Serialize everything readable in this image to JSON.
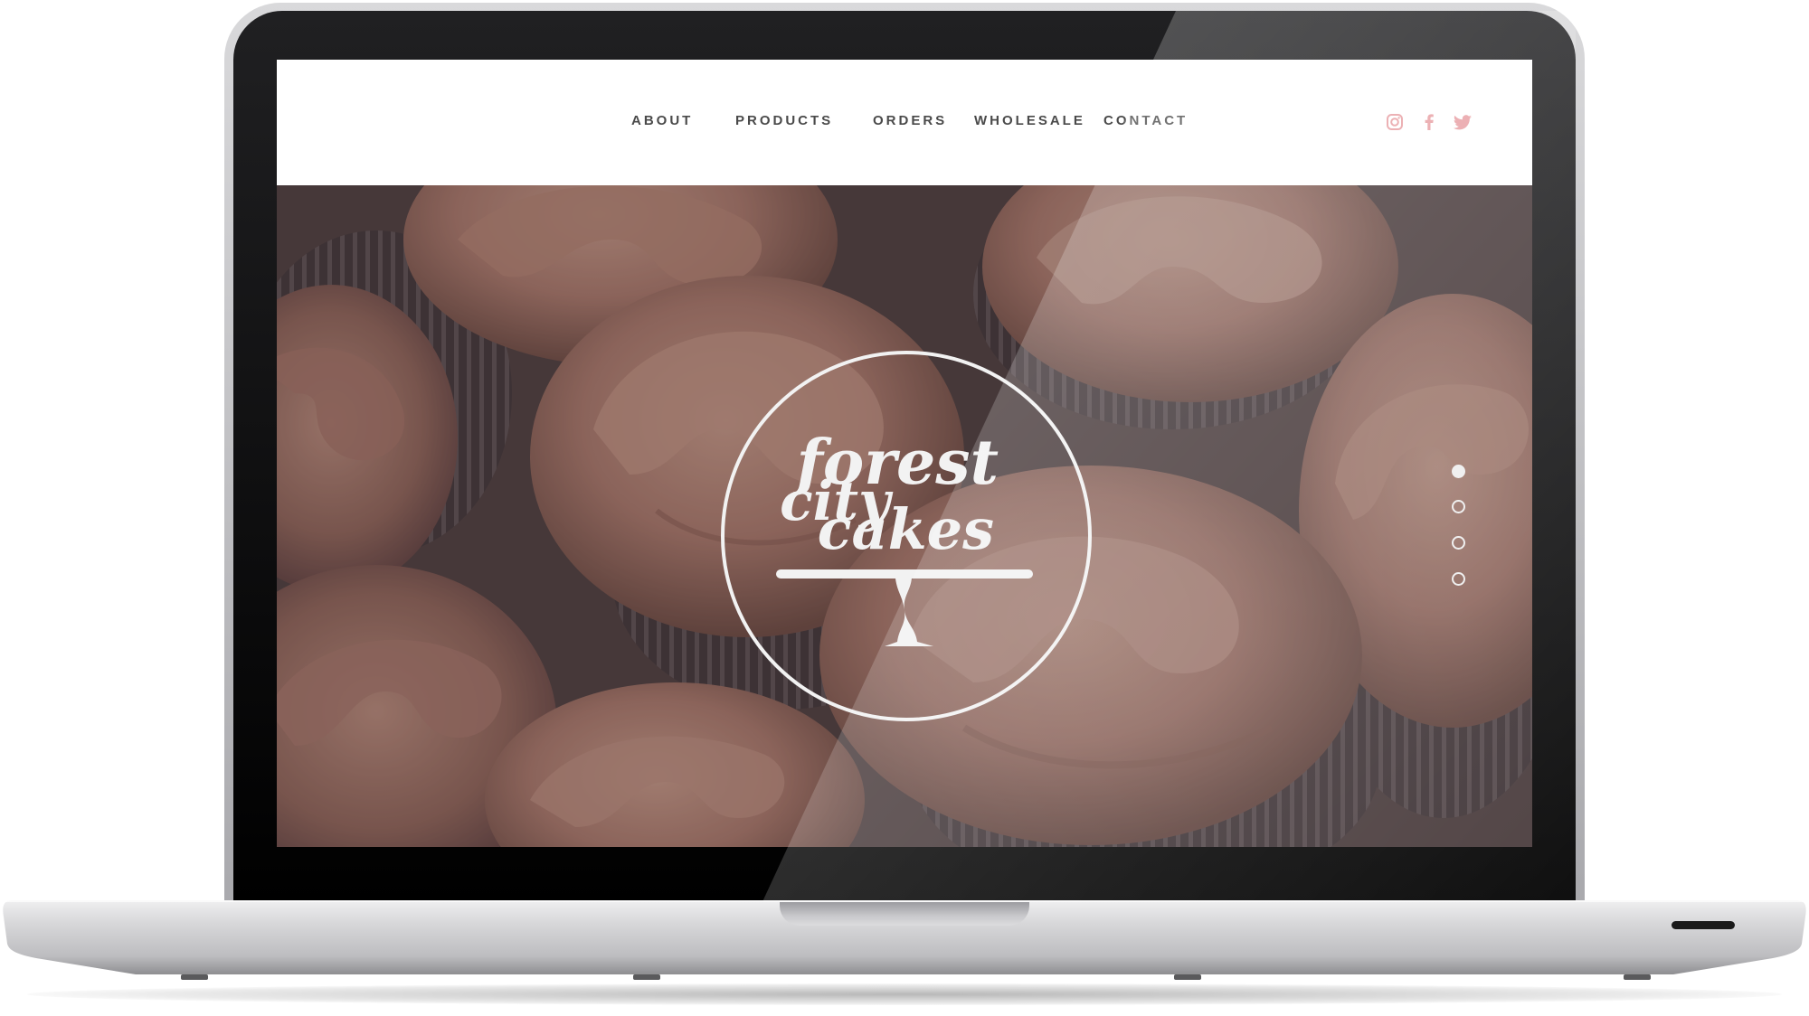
{
  "nav": {
    "items": [
      {
        "label": "ABOUT"
      },
      {
        "label": "PRODUCTS"
      },
      {
        "label": "ORDERS"
      },
      {
        "label": "WHOLESALE"
      },
      {
        "label": "CONTACT"
      }
    ]
  },
  "social": {
    "icons": [
      "instagram-icon",
      "facebook-icon",
      "twitter-icon"
    ],
    "color": "#e8a0a4"
  },
  "hero": {
    "logo": {
      "line1": "forest",
      "line2": "city",
      "line3": "cakes"
    },
    "slider": {
      "count": 4,
      "active": 1
    }
  },
  "colors": {
    "nav_text": "#4a4a4a",
    "header_bg": "#ffffff",
    "logo": "#f2f2f2"
  }
}
